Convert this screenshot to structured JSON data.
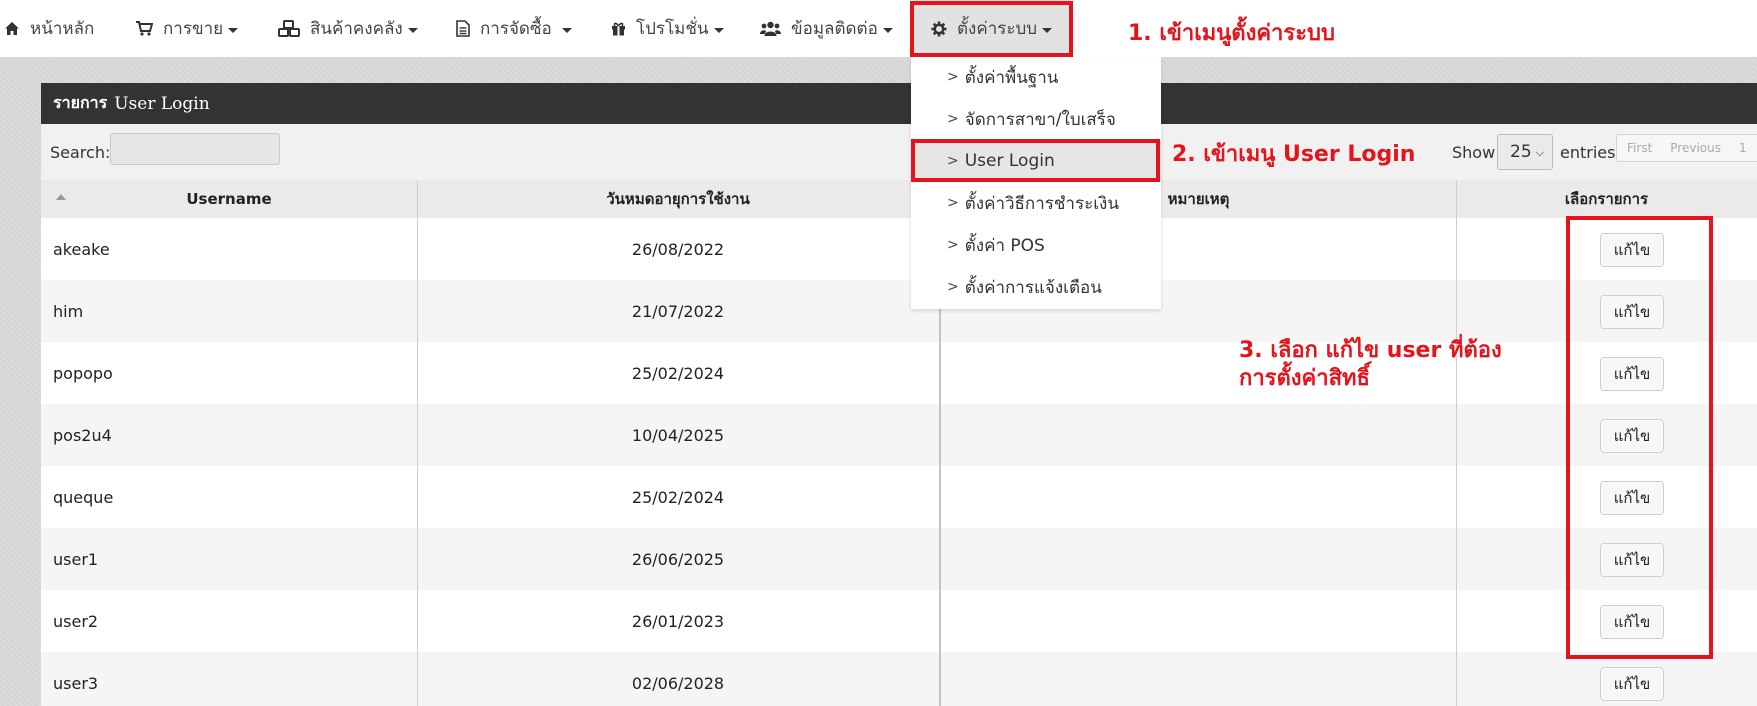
{
  "nav": {
    "items": [
      {
        "label": "หน้าหลัก",
        "icon": "home-icon",
        "dropdown": false
      },
      {
        "label": "การขาย",
        "icon": "cart-icon",
        "dropdown": true
      },
      {
        "label": "สินค้าคงคลัง",
        "icon": "cubes-icon",
        "dropdown": true
      },
      {
        "label": "การจัดซื้อ",
        "icon": "document-icon",
        "dropdown": true
      },
      {
        "label": "โปรโมชั่น",
        "icon": "gift-icon",
        "dropdown": true
      },
      {
        "label": "ข้อมูลติดต่อ",
        "icon": "users-icon",
        "dropdown": true
      },
      {
        "label": "ตั้งค่าระบบ",
        "icon": "gear-icon",
        "dropdown": true
      }
    ]
  },
  "dropdown": {
    "items": [
      {
        "label": "ตั้งค่าพื้นฐาน"
      },
      {
        "label": "จัดการสาขา/ใบเสร็จ"
      },
      {
        "label": "User Login"
      },
      {
        "label": "ตั้งค่าวิธีการชำระเงิน"
      },
      {
        "label": "ตั้งค่า POS"
      },
      {
        "label": "ตั้งค่าการแจ้งเตือน"
      }
    ],
    "selected_index": 2
  },
  "panel": {
    "title_th": "รายการ",
    "title_en": "User Login"
  },
  "toolbar": {
    "search_label": "Search:",
    "search_value": "",
    "show_label": "Show",
    "page_size": "25",
    "entries_label": "entries",
    "pager": {
      "first": "First",
      "previous": "Previous",
      "page": "1"
    }
  },
  "table": {
    "headers": [
      "Username",
      "วันหมดอายุการใช้งาน",
      "หมายเหตุ",
      "เลือกรายการ"
    ],
    "edit_label": "แก้ไข",
    "rows": [
      {
        "username": "akeake",
        "expiry": "26/08/2022",
        "note": ""
      },
      {
        "username": "him",
        "expiry": "21/07/2022",
        "note": ""
      },
      {
        "username": "popopo",
        "expiry": "25/02/2024",
        "note": ""
      },
      {
        "username": "pos2u4",
        "expiry": "10/04/2025",
        "note": ""
      },
      {
        "username": "queque",
        "expiry": "25/02/2024",
        "note": ""
      },
      {
        "username": "user1",
        "expiry": "26/06/2025",
        "note": ""
      },
      {
        "username": "user2",
        "expiry": "26/01/2023",
        "note": ""
      },
      {
        "username": "user3",
        "expiry": "02/06/2028",
        "note": ""
      }
    ]
  },
  "annotations": {
    "step1": "1. เข้าเมนูตั้งค่าระบบ",
    "step2": "2. เข้าเมนู User Login",
    "step3_line1": "3. เลือก แก้ไข user ที่ต้อง",
    "step3_line2": "การตั้งค่าสิทธิ์"
  },
  "colors": {
    "annotation_red": "#e3141b",
    "panel_header": "#333333",
    "navbar_bg": "#ffffff"
  }
}
